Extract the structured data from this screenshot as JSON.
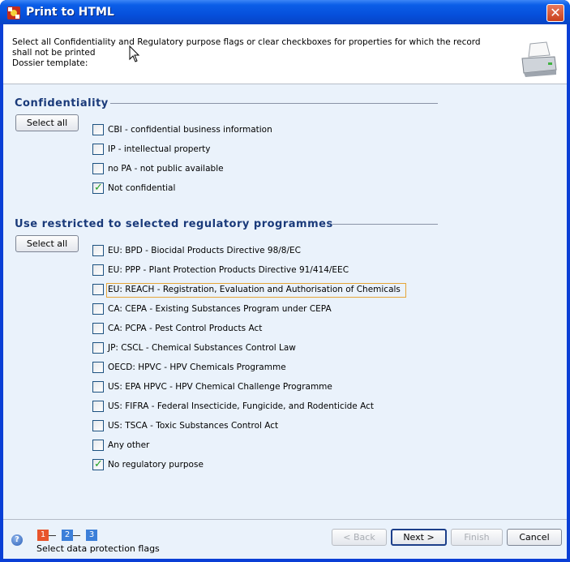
{
  "window": {
    "title": "Print to HTML",
    "close_label": "✕"
  },
  "header": {
    "description_line1": "Select all Confidentiality and Regulatory purpose flags or clear checkboxes for properties for which the record",
    "description_line2": "shall not be printed",
    "template_label": "Dossier template:"
  },
  "confidentiality": {
    "title": "Confidentiality",
    "select_all_label": "Select all",
    "options": [
      {
        "label": "CBI - confidential business information",
        "checked": false
      },
      {
        "label": "IP - intellectual property",
        "checked": false
      },
      {
        "label": "no PA - not public available",
        "checked": false
      },
      {
        "label": "Not confidential",
        "checked": true
      }
    ]
  },
  "regulatory": {
    "title": "Use restricted to selected regulatory programmes",
    "select_all_label": "Select all",
    "options": [
      {
        "label": "EU: BPD - Biocidal Products Directive 98/8/EC",
        "checked": false
      },
      {
        "label": "EU: PPP - Plant Protection Products Directive 91/414/EEC",
        "checked": false
      },
      {
        "label": "EU: REACH - Registration, Evaluation and Authorisation of Chemicals",
        "checked": false,
        "focused": true
      },
      {
        "label": "CA: CEPA - Existing Substances Program under CEPA",
        "checked": false
      },
      {
        "label": "CA: PCPA - Pest Control Products Act",
        "checked": false
      },
      {
        "label": "JP: CSCL - Chemical Substances Control Law",
        "checked": false
      },
      {
        "label": "OECD: HPVC - HPV Chemicals Programme",
        "checked": false
      },
      {
        "label": "US: EPA HPVC - HPV Chemical Challenge Programme",
        "checked": false
      },
      {
        "label": "US: FIFRA - Federal Insecticide, Fungicide, and Rodenticide Act",
        "checked": false
      },
      {
        "label": "US: TSCA - Toxic Substances Control Act",
        "checked": false
      },
      {
        "label": "Any other",
        "checked": false
      },
      {
        "label": "No regulatory purpose",
        "checked": true
      }
    ]
  },
  "wizard": {
    "steps": [
      "1",
      "2",
      "3"
    ],
    "current_step": 1,
    "caption": "Select data protection flags",
    "help_label": "?"
  },
  "buttons": {
    "back": "< Back",
    "next": "Next >",
    "finish": "Finish",
    "cancel": "Cancel"
  },
  "colors": {
    "accent": "#e8542b",
    "step_inactive": "#3c7fd9",
    "check": "#21a121",
    "focus": "#e5a538"
  }
}
